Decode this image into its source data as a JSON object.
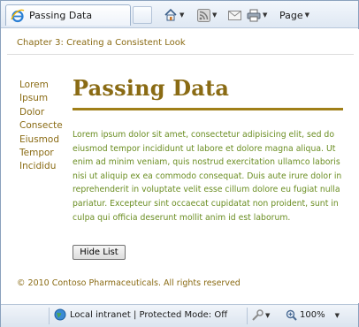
{
  "browser": {
    "tab_title": "Passing Data",
    "page_menu_label": "Page"
  },
  "page": {
    "chapter_link": "Chapter 3: Creating a Consistent Look",
    "sidebar": [
      "Lorem",
      "Ipsum",
      "Dolor",
      "Consecte",
      "Eiusmod",
      "Tempor",
      "Incididu"
    ],
    "heading": "Passing Data",
    "paragraph": "Lorem ipsum dolor sit amet, consectetur adipisicing elit, sed do eiusmod tempor incididunt ut labore et dolore magna aliqua. Ut enim ad minim veniam, quis nostrud exercitation ullamco laboris nisi ut aliquip ex ea commodo consequat. Duis aute irure dolor in reprehenderit in voluptate velit esse cillum dolore eu fugiat nulla pariatur. Excepteur sint occaecat cupidatat non proident, sunt in culpa qui officia deserunt mollit anim id est laborum.",
    "hide_button": "Hide List",
    "footer": "© 2010 Contoso Pharmaceuticals. All rights reserved"
  },
  "statusbar": {
    "zone": "Local intranet | Protected Mode: Off",
    "zoom": "100%"
  }
}
